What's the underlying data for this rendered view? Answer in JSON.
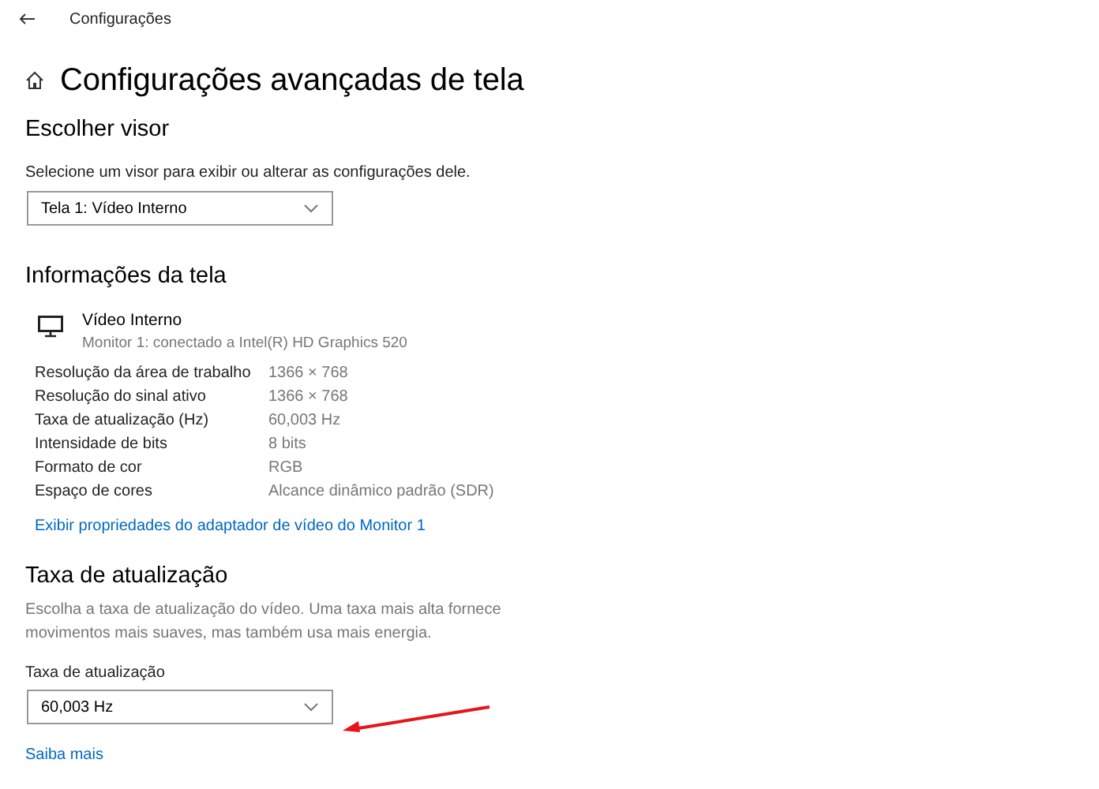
{
  "window": {
    "title": "Configurações"
  },
  "page_title": "Configurações avançadas de tela",
  "choose_display": {
    "heading": "Escolher visor",
    "description": "Selecione um visor para exibir ou alterar as configurações dele.",
    "dropdown": {
      "value": "Tela 1: Vídeo Interno"
    }
  },
  "display_info": {
    "heading": "Informações da tela",
    "monitor": {
      "name": "Vídeo Interno",
      "subtitle": "Monitor 1: conectado a Intel(R) HD Graphics 520"
    },
    "rows": [
      {
        "label": "Resolução da área de trabalho",
        "value": "1366 × 768"
      },
      {
        "label": "Resolução do sinal ativo",
        "value": "1366 × 768"
      },
      {
        "label": "Taxa de atualização (Hz)",
        "value": "60,003 Hz"
      },
      {
        "label": "Intensidade de bits",
        "value": "8 bits"
      },
      {
        "label": "Formato de cor",
        "value": "RGB"
      },
      {
        "label": "Espaço de cores",
        "value": "Alcance dinâmico padrão (SDR)"
      }
    ],
    "link": "Exibir propriedades do adaptador de vídeo do Monitor 1"
  },
  "refresh_rate": {
    "heading": "Taxa de atualização",
    "description": "Escolha a taxa de atualização do vídeo. Uma taxa mais alta fornece movimentos mais suaves, mas também usa mais energia.",
    "field_label": "Taxa de atualização",
    "dropdown": {
      "value": "60,003 Hz"
    },
    "link": "Saiba mais"
  }
}
